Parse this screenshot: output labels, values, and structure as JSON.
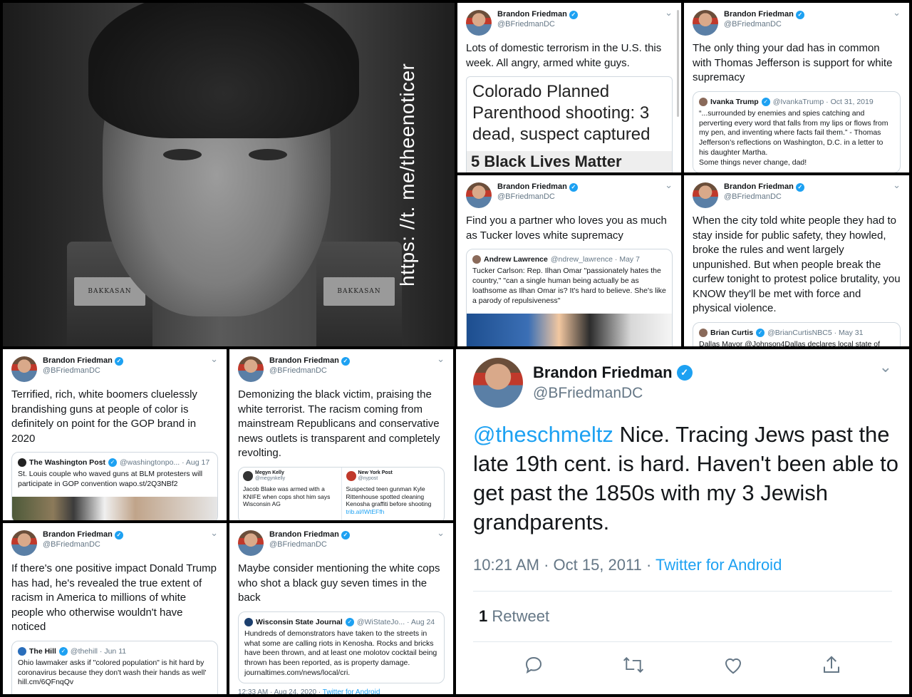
{
  "photo": {
    "url_text": "https: //t. me/theenoticer",
    "jar_left_label": "BAKKASAN",
    "jar_right_label": "BAKKASAN"
  },
  "author": {
    "name": "Brandon Friedman",
    "handle": "@BFriedmanDC",
    "verified_glyph": "✓",
    "caret": "⌄"
  },
  "tweets": {
    "t1": {
      "text": "Lots of domestic terrorism in the U.S. this week. All angry, armed white guys.",
      "article_headline": "Colorado Planned Parenthood shooting: 3 dead, suspect captured",
      "article_sub": "5 Black Lives Matter"
    },
    "t2": {
      "text": "The only thing your dad has in common with Thomas Jefferson is support for white supremacy",
      "quote_name": "Ivanka Trump",
      "quote_meta": "@IvankaTrump · Oct 31, 2019",
      "quote_text": "“...surrounded by enemies and spies catching and perverting every word that falls from my lips or flows from my pen, and inventing where facts fail them.” - Thomas Jefferson’s reflections on Washington, D.C. in a letter to his daughter Martha.",
      "quote_text2": "Some things never change, dad!"
    },
    "t3": {
      "text": "Find you a partner who loves you as much as Tucker loves white supremacy",
      "quote_name": "Andrew Lawrence",
      "quote_meta": "@ndrew_lawrence · May 7",
      "quote_text": "Tucker Carlson: Rep. Ilhan Omar \"passionately hates the country,\" \"can a single human being actually be as loathsome as Ilhan Omar is? It's hard to believe. She's like a parody of repulsiveness\""
    },
    "t4": {
      "text": "When the city told white people they had to stay inside for public safety, they howled, broke the rules and went largely unpunished. But when people break the curfew tonight to protest police brutality, you KNOW they'll be met with force and physical violence.",
      "quote_name": "Brian Curtis",
      "quote_meta": "@BrianCurtisNBC5 · May 31",
      "quote_text": "Dallas Mayor @Johnson4Dallas declares local state of"
    },
    "t5": {
      "text": "Terrified, rich, white boomers cluelessly brandishing guns at people of color is definitely on point for the GOP brand in 2020",
      "quote_name": "The Washington Post",
      "quote_meta": "@washingtonpo... · Aug 17",
      "quote_text": "St. Louis couple who waved guns at BLM protesters will participate in GOP convention wapo.st/2Q3NBf2"
    },
    "t6": {
      "text": "Demonizing the black victim, praising the white terrorist. The racism coming from mainstream Republicans and conservative news outlets is transparent and completely revolting.",
      "left_name": "Megyn Kelly",
      "left_handle": "@megynkelly",
      "left_text": "Jacob Blake was armed with a KNIFE when cops shot him says Wisconsin AG",
      "right_name": "New York Post",
      "right_handle": "@nypost",
      "right_text": "Suspected teen gunman Kyle Rittenhouse spotted cleaning Kenosha graffiti before shooting",
      "right_link": "trib.al/IWtEFfh"
    },
    "t7": {
      "text": "If there's one positive impact Donald Trump has had, he's revealed the true extent of racism in America to millions of white people who otherwise wouldn't have noticed",
      "quote_name": "The Hill",
      "quote_meta": "@thehill · Jun 11",
      "quote_text": "Ohio lawmaker asks if \"colored population\" is hit hard by coronavirus because they don't wash their hands as well' hill.cm/6QFnqQv"
    },
    "t8": {
      "text": "Maybe consider mentioning the white cops who shot a black guy seven times in the back",
      "quote_name": "Wisconsin State Journal",
      "quote_meta": "@WiStateJo... · Aug 24",
      "quote_text": "Hundreds of demonstrators have taken to the streets in what some are calling riots in Kenosha. Rocks and bricks have been thrown, and at least one molotov cocktail being thrown has been reported, as is property damage. journaltimes.com/news/local/cri.",
      "footer_time": "12:33 AM · Aug 24, 2020 · ",
      "footer_source": "Twitter for Android"
    },
    "main": {
      "mention": "@theschmeltz",
      "text": " Nice. Tracing Jews past the late 19th cent. is hard. Haven't been able to get past the 1850s with my 3 Jewish grandparents.",
      "time": "10:21 AM · Oct 15, 2011 · ",
      "source": "Twitter for Android",
      "retweet_count": "1",
      "retweet_label": " Retweet",
      "icons": {
        "reply": "reply-icon",
        "retweet": "retweet-icon",
        "like": "heart-icon",
        "share": "share-icon"
      }
    }
  }
}
